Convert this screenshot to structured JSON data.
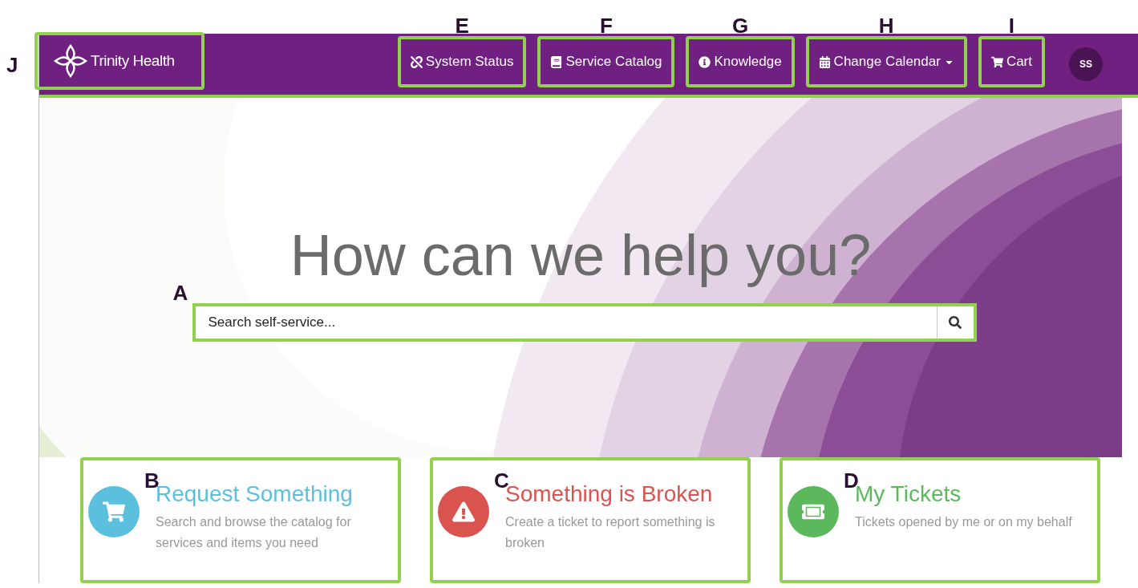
{
  "header": {
    "logo": "Trinity Health",
    "logo_marker": "J",
    "avatar": "SS",
    "nav": [
      {
        "kind": "status",
        "label": "System Status",
        "marker": "E",
        "dropdown": false
      },
      {
        "kind": "book",
        "label": "Service Catalog",
        "marker": "F",
        "dropdown": false
      },
      {
        "kind": "info",
        "label": "Knowledge",
        "marker": "G",
        "dropdown": false
      },
      {
        "kind": "calendar",
        "label": "Change Calendar",
        "marker": "H",
        "dropdown": true
      },
      {
        "kind": "cart",
        "label": "Cart",
        "marker": "I",
        "dropdown": false
      }
    ]
  },
  "hero": {
    "heading": "How can we help you?",
    "search": {
      "placeholder": "Search self-service...",
      "marker": "A"
    }
  },
  "cards": [
    {
      "kind": "cart",
      "title": "Request Something",
      "description": "Search and browse the catalog for services and items you need",
      "color": "#5bc0de",
      "marker": "B"
    },
    {
      "kind": "warning",
      "title": "Something is Broken",
      "description": "Create a ticket to report something is broken",
      "color": "#d9534f",
      "marker": "C"
    },
    {
      "kind": "ticket",
      "title": "My Tickets",
      "description": "Tickets opened by me or on my behalf",
      "color": "#5cb85c",
      "marker": "D"
    }
  ]
}
